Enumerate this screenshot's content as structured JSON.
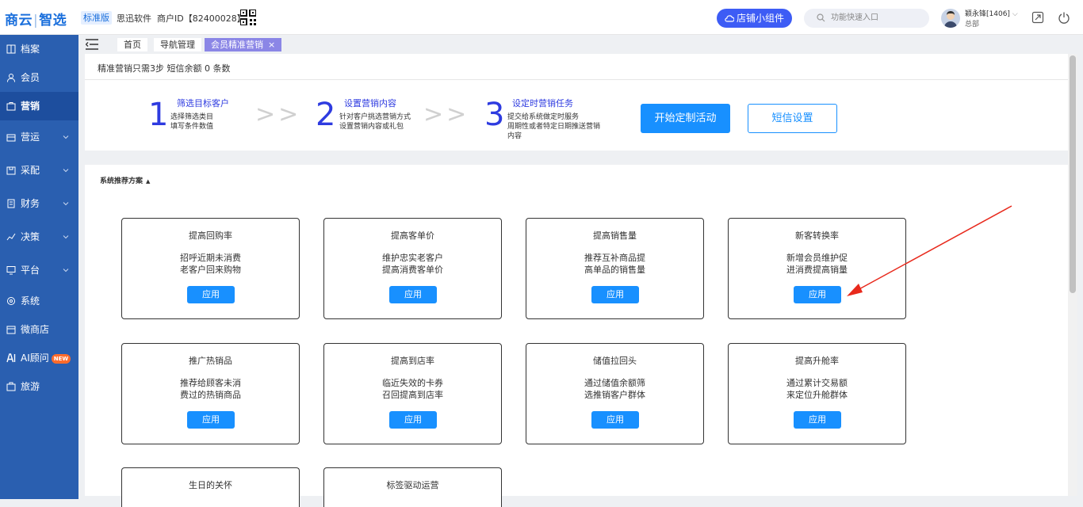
{
  "topbar": {
    "logo_part1": "商云",
    "logo_sep": "|",
    "logo_part2": "智选",
    "edition": "标准版",
    "company": "思迅软件",
    "tenant_label": "商户ID【82400028】",
    "shop_widget": "店铺小组件",
    "search_placeholder": "功能快速入口",
    "user_name": "颖永锋[1406]",
    "user_org": "总部"
  },
  "sidebar": {
    "items": [
      {
        "label": "档案",
        "icon": "archive-icon",
        "has_chevron": false
      },
      {
        "label": "会员",
        "icon": "user-icon",
        "has_chevron": false
      },
      {
        "label": "营销",
        "icon": "marketing-icon",
        "has_chevron": false,
        "active": true
      },
      {
        "label": "营运",
        "icon": "operation-icon",
        "has_chevron": true
      },
      {
        "label": "采配",
        "icon": "purchase-icon",
        "has_chevron": true
      },
      {
        "label": "财务",
        "icon": "finance-icon",
        "has_chevron": true
      },
      {
        "label": "决策",
        "icon": "decision-icon",
        "has_chevron": true
      },
      {
        "label": "平台",
        "icon": "platform-icon",
        "has_chevron": true
      },
      {
        "label": "系统",
        "icon": "system-icon",
        "has_chevron": false
      },
      {
        "label": "微商店",
        "icon": "micro-store-icon",
        "has_chevron": false
      },
      {
        "label": "AI顾问",
        "icon": "ai-icon",
        "has_chevron": false,
        "badge": "NEW"
      },
      {
        "label": "旅游",
        "icon": "travel-icon",
        "has_chevron": false
      }
    ],
    "bg_color": "#2a5fb0"
  },
  "tabs": [
    {
      "label": "首页",
      "active": false
    },
    {
      "label": "导航管理",
      "active": false
    },
    {
      "label": "会员精准营销",
      "active": true,
      "closable": "×"
    }
  ],
  "notice": "精准营销只需3步  短信余额 0 条数",
  "steps": [
    {
      "num": "1",
      "title": "筛选目标客户",
      "desc_1": "选择筛选类目",
      "desc_2": "填写条件数值"
    },
    {
      "num": "2",
      "title": "设置营销内容",
      "desc_1": "针对客户挑选营销方式",
      "desc_2": "设置营销内容或礼包"
    },
    {
      "num": "3",
      "title": "设定时营销任务",
      "desc_1": "提交给系统做定时服务",
      "desc_2": "周期性或者特定日期推送营销",
      "desc_3": "内容"
    }
  ],
  "step_arrow": ">>",
  "buttons": {
    "start": "开始定制活动",
    "sms_settings": "短信设置"
  },
  "section_title": "系统推荐方案",
  "cards": [
    {
      "title": "提高回购率",
      "desc_1": "招呼近期未消费",
      "desc_2": "老客户回来购物",
      "button": "应用"
    },
    {
      "title": "提高客单价",
      "desc_1": "维护忠实老客户",
      "desc_2": "提高消费客单价",
      "button": "应用"
    },
    {
      "title": "提高销售量",
      "desc_1": "推荐互补商品提",
      "desc_2": "高单品的销售量",
      "button": "应用"
    },
    {
      "title": "新客转换率",
      "desc_1": "新增会员维护促",
      "desc_2": "进消费提高销量",
      "button": "应用"
    },
    {
      "title": "推广热销品",
      "desc_1": "推荐给顾客未消",
      "desc_2": "费过的热销商品",
      "button": "应用"
    },
    {
      "title": "提高到店率",
      "desc_1": "临近失效的卡券",
      "desc_2": "召回提高到店率",
      "button": "应用"
    },
    {
      "title": "储值拉回头",
      "desc_1": "通过储值余额筛",
      "desc_2": "选推销客户群体",
      "button": "应用"
    },
    {
      "title": "提高升舱率",
      "desc_1": "通过累计交易额",
      "desc_2": "来定位升舱群体",
      "button": "应用"
    },
    {
      "title": "生日的关怀",
      "desc_1": "",
      "desc_2": "",
      "button": ""
    },
    {
      "title": "标签驱动运营",
      "desc_1": "",
      "desc_2": "",
      "button": ""
    }
  ],
  "colors": {
    "primary": "#1890ff",
    "step_blue": "#2e3be0",
    "tab_active": "#8b86e6",
    "annotation_arrow": "#e8291c"
  }
}
